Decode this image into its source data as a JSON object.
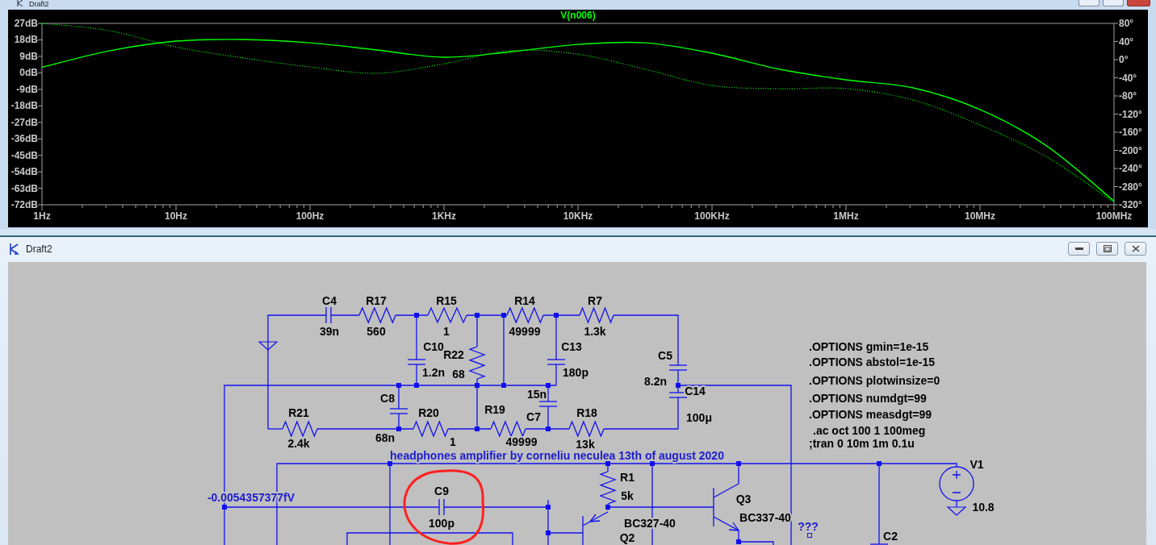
{
  "plot_window": {
    "title": "Draft2",
    "chart_data": {
      "type": "line",
      "title": "V(n006)",
      "categories": [
        "1Hz",
        null,
        "10Hz",
        null,
        "100Hz",
        null,
        "1KHz",
        null,
        "10KHz",
        null,
        "100KHz",
        null,
        "1MHz",
        null,
        "10MHz",
        null,
        "100MHz"
      ],
      "ylim": [
        -72,
        27
      ],
      "yticks": [
        {
          "value": 27,
          "label": "27dB"
        },
        {
          "value": 18,
          "label": "18dB"
        },
        {
          "value": 9,
          "label": "9dB"
        },
        {
          "value": 0,
          "label": "0dB"
        },
        {
          "value": -9,
          "label": "-9dB"
        },
        {
          "value": -18,
          "label": "-18dB"
        },
        {
          "value": -27,
          "label": "-27dB"
        },
        {
          "value": -36,
          "label": "-36dB"
        },
        {
          "value": -45,
          "label": "-45dB"
        },
        {
          "value": -54,
          "label": "-54dB"
        },
        {
          "value": -63,
          "label": "-63dB"
        },
        {
          "value": -72,
          "label": "-72dB"
        }
      ],
      "y2lim": [
        -320,
        80
      ],
      "y2ticks": [
        {
          "value": 80,
          "label": "80°"
        },
        {
          "value": 40,
          "label": "40°"
        },
        {
          "value": 0,
          "label": "0°"
        },
        {
          "value": -40,
          "label": "-40°"
        },
        {
          "value": -80,
          "label": "-80°"
        },
        {
          "value": -120,
          "label": "-120°"
        },
        {
          "value": -160,
          "label": "-160°"
        },
        {
          "value": -200,
          "label": "-200°"
        },
        {
          "value": -240,
          "label": "-240°"
        },
        {
          "value": -280,
          "label": "-280°"
        },
        {
          "value": -320,
          "label": "-320°"
        }
      ],
      "series": [
        {
          "color": "#00ff00",
          "line_style": "solid",
          "values": [
            3,
            12,
            17.3,
            18.2,
            16.4,
            12.5,
            8.5,
            11.5,
            15.5,
            16.4,
            10.7,
            2,
            -3.8,
            -8.2,
            -20,
            -40,
            -70
          ]
        },
        {
          "color": "#00ff00",
          "axis": "y2",
          "line_style": "dotted",
          "values": [
            80,
            64,
            28,
            4,
            -16,
            -30,
            -9,
            20,
            12,
            -21,
            -57,
            -64,
            -64,
            -89,
            -144,
            -215,
            -315
          ]
        }
      ]
    }
  },
  "schematic_window": {
    "title": "Draft2",
    "components": [
      {
        "kind": "capacitor",
        "ref": "C4",
        "value": "39n"
      },
      {
        "kind": "resistor",
        "ref": "R17",
        "value": "560"
      },
      {
        "kind": "resistor",
        "ref": "R15",
        "value": "1"
      },
      {
        "kind": "resistor",
        "ref": "R14",
        "value": "49999"
      },
      {
        "kind": "resistor",
        "ref": "R7",
        "value": "1.3k"
      },
      {
        "kind": "capacitor",
        "ref": "C10",
        "value": "1.2n"
      },
      {
        "kind": "resistor",
        "ref": "R22",
        "value": "68"
      },
      {
        "kind": "capacitor",
        "ref": "C13",
        "value": "180p"
      },
      {
        "kind": "capacitor",
        "ref": "C5",
        "value": "8.2n"
      },
      {
        "kind": "capacitor",
        "ref": "C14",
        "value": "100μ"
      },
      {
        "kind": "capacitor",
        "ref": "C8",
        "value": "68n"
      },
      {
        "kind": "resistor",
        "ref": "R21",
        "value": "2.4k"
      },
      {
        "kind": "resistor",
        "ref": "R20",
        "value": "1"
      },
      {
        "kind": "resistor",
        "ref": "R19",
        "value": "49999"
      },
      {
        "kind": "capacitor",
        "ref": "C7",
        "value": "15n"
      },
      {
        "kind": "resistor",
        "ref": "R18",
        "value": "13k"
      },
      {
        "kind": "capacitor",
        "ref": "C9",
        "value": "100p"
      },
      {
        "kind": "resistor",
        "ref": "R1",
        "value": "5k"
      },
      {
        "kind": "npn",
        "ref": "Q3",
        "value": "BC337-40"
      },
      {
        "kind": "pnp",
        "ref": "Q2",
        "value": "BC327-40"
      },
      {
        "kind": "voltage_source",
        "ref": "V1",
        "value": "10.8"
      },
      {
        "kind": "capacitor",
        "ref": "C2"
      }
    ],
    "labels": [
      {
        "text": "headphones amplifier by corneliu neculea 13th of august 2020"
      },
      {
        "text": "-0.0054357377fV"
      },
      {
        "text": "???"
      }
    ],
    "directives": [
      ".OPTIONS gmin=1e-15",
      ".OPTIONS abstol=1e-15",
      ".OPTIONS plotwinsize=0",
      ".OPTIONS numdgt=99",
      ".OPTIONS measdgt=99",
      ".ac oct 100 1 100meg",
      ";tran 0 10m 1m 0.1u"
    ]
  }
}
